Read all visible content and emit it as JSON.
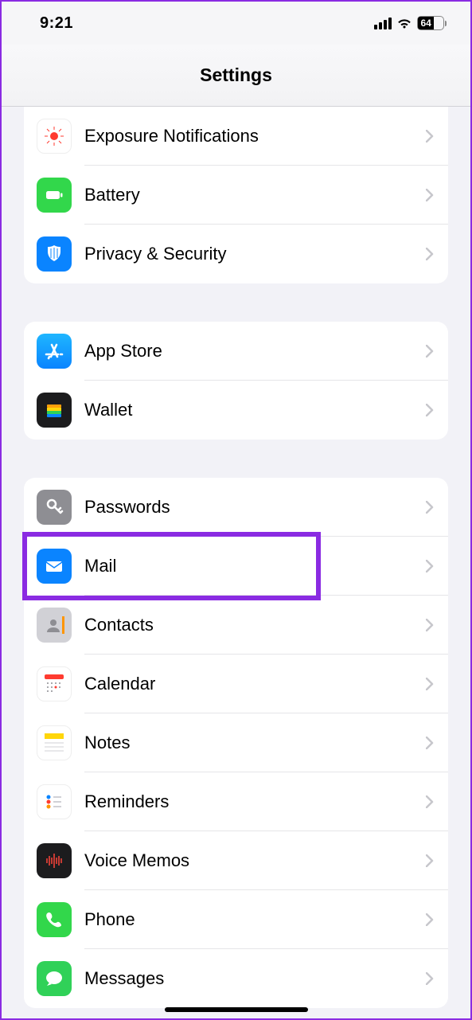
{
  "status": {
    "time": "9:21",
    "battery": "64"
  },
  "header": {
    "title": "Settings"
  },
  "groups": [
    {
      "rows": [
        {
          "key": "exposure",
          "label": "Exposure Notifications"
        },
        {
          "key": "battery",
          "label": "Battery"
        },
        {
          "key": "privacy",
          "label": "Privacy & Security"
        }
      ]
    },
    {
      "rows": [
        {
          "key": "appstore",
          "label": "App Store"
        },
        {
          "key": "wallet",
          "label": "Wallet"
        }
      ]
    },
    {
      "rows": [
        {
          "key": "passwords",
          "label": "Passwords"
        },
        {
          "key": "mail",
          "label": "Mail",
          "highlighted": true
        },
        {
          "key": "contacts",
          "label": "Contacts"
        },
        {
          "key": "calendar",
          "label": "Calendar"
        },
        {
          "key": "notes",
          "label": "Notes"
        },
        {
          "key": "reminders",
          "label": "Reminders"
        },
        {
          "key": "voicememos",
          "label": "Voice Memos"
        },
        {
          "key": "phone",
          "label": "Phone"
        },
        {
          "key": "messages",
          "label": "Messages"
        }
      ]
    }
  ]
}
